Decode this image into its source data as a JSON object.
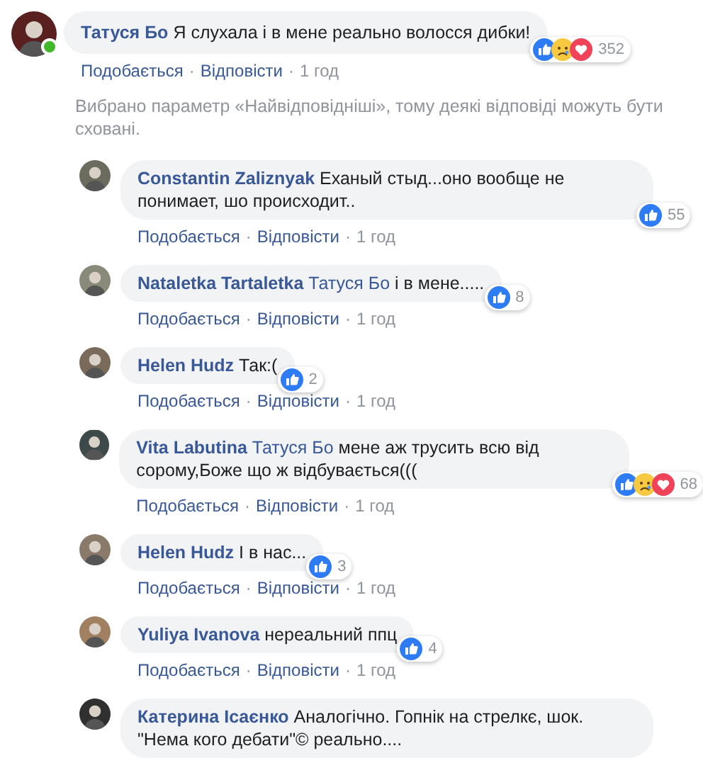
{
  "comment": {
    "author": "Татуся Бо",
    "text": "Я слухала і в мене реально волосся дибки!",
    "online": true,
    "reactions": {
      "icons": [
        {
          "kind": "like"
        },
        {
          "kind": "sad"
        },
        {
          "kind": "love"
        }
      ],
      "count": "352"
    },
    "actions": [
      {
        "kind": "link",
        "text": "Подобається"
      },
      {
        "kind": "separator",
        "text": "·"
      },
      {
        "kind": "link",
        "text": "Відповісти"
      },
      {
        "kind": "separator",
        "text": "·"
      },
      {
        "kind": "time",
        "text": "1 год"
      }
    ]
  },
  "notice": "Вибрано параметр «Найвідповідніші», тому деякі відповіді можуть бути сховані.",
  "replies": [
    {
      "author": "Constantin Zaliznyak",
      "text": "Еханый стыд...оно вообще не понимает, шо происходит..",
      "reactions": {
        "icons": [
          {
            "kind": "like"
          }
        ],
        "count": "55"
      },
      "actions": [
        {
          "kind": "link",
          "text": "Подобається"
        },
        {
          "kind": "separator",
          "text": "·"
        },
        {
          "kind": "link",
          "text": "Відповісти"
        },
        {
          "kind": "separator",
          "text": "·"
        },
        {
          "kind": "time",
          "text": "1 год"
        }
      ]
    },
    {
      "author": "Nataletka Tartaletka",
      "mention": "Татуся Бо",
      "text": "і в мене.....",
      "reactions": {
        "icons": [
          {
            "kind": "like"
          }
        ],
        "count": "8"
      },
      "actions": [
        {
          "kind": "link",
          "text": "Подобається"
        },
        {
          "kind": "separator",
          "text": "·"
        },
        {
          "kind": "link",
          "text": "Відповісти"
        },
        {
          "kind": "separator",
          "text": "·"
        },
        {
          "kind": "time",
          "text": "1 год"
        }
      ]
    },
    {
      "author": "Helen Hudz",
      "text": "Так:(",
      "reactions": {
        "icons": [
          {
            "kind": "like"
          }
        ],
        "count": "2"
      },
      "actions": [
        {
          "kind": "link",
          "text": "Подобається"
        },
        {
          "kind": "separator",
          "text": "·"
        },
        {
          "kind": "link",
          "text": "Відповісти"
        },
        {
          "kind": "separator",
          "text": "·"
        },
        {
          "kind": "time",
          "text": "1 год"
        }
      ]
    },
    {
      "author": "Vita Labutina",
      "mention": "Татуся Бо",
      "text": "мене аж трусить всю від сорому,Боже що ж відбувається(((",
      "reactions": {
        "icons": [
          {
            "kind": "like"
          },
          {
            "kind": "sad"
          },
          {
            "kind": "love"
          }
        ],
        "count": "68"
      },
      "actions": [
        {
          "kind": "link",
          "text": "Подобається"
        },
        {
          "kind": "separator",
          "text": "·"
        },
        {
          "kind": "link",
          "text": "Відповісти"
        },
        {
          "kind": "separator",
          "text": "·"
        },
        {
          "kind": "time",
          "text": "1 год"
        }
      ]
    },
    {
      "author": "Helen Hudz",
      "text": "І в нас...",
      "reactions": {
        "icons": [
          {
            "kind": "like"
          }
        ],
        "count": "3"
      },
      "actions": [
        {
          "kind": "link",
          "text": "Подобається"
        },
        {
          "kind": "separator",
          "text": "·"
        },
        {
          "kind": "link",
          "text": "Відповісти"
        },
        {
          "kind": "separator",
          "text": "·"
        },
        {
          "kind": "time",
          "text": "1 год"
        }
      ]
    },
    {
      "author": "Yuliya Ivanova",
      "text": "нереальний ппц",
      "reactions": {
        "icons": [
          {
            "kind": "like"
          }
        ],
        "count": "4"
      },
      "actions": [
        {
          "kind": "link",
          "text": "Подобається"
        },
        {
          "kind": "separator",
          "text": "·"
        },
        {
          "kind": "link",
          "text": "Відповісти"
        },
        {
          "kind": "separator",
          "text": "·"
        },
        {
          "kind": "time",
          "text": "1 год"
        }
      ]
    },
    {
      "author": "Катерина Ісаєнко",
      "text": "Аналогічно. Гопнік на стрелкє, шок. \"Нема кого дебати\"© реально...."
    }
  ]
}
